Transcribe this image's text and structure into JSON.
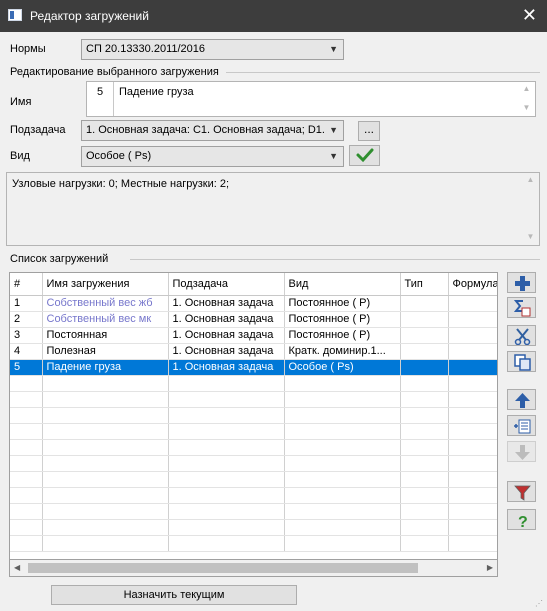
{
  "window": {
    "title": "Редактор загружений",
    "close_glyph": "✕"
  },
  "norms": {
    "label": "Нормы",
    "value": "СП 20.13330.2011/2016"
  },
  "edit_group": {
    "title": "Редактирование выбранного загружения"
  },
  "name": {
    "label": "Имя",
    "number": "5",
    "value": "Падение груза"
  },
  "subtask": {
    "label": "Подзадача",
    "value": "1. Основная задача: C1. Основная задача; D1.",
    "more_label": "..."
  },
  "kind": {
    "label": "Вид",
    "value": "Особое ( Ps)"
  },
  "info": {
    "text": "Узловые нагрузки:  0;  Местные нагрузки:  2;"
  },
  "list": {
    "title": "Список загружений",
    "columns": [
      "#",
      "Имя загружения",
      "Подзадача",
      "Вид",
      "Тип",
      "Формула"
    ],
    "rows": [
      {
        "num": "1",
        "name": "Собственный вес жб",
        "subtask": "1. Основная задача",
        "kind": "Постоянное ( P)",
        "type": "",
        "formula": ""
      },
      {
        "num": "2",
        "name": "Собственный вес мк",
        "subtask": "1. Основная задача",
        "kind": "Постоянное ( P)",
        "type": "",
        "formula": ""
      },
      {
        "num": "3",
        "name": "Постоянная",
        "subtask": "1. Основная задача",
        "kind": "Постоянное ( P)",
        "type": "",
        "formula": ""
      },
      {
        "num": "4",
        "name": "Полезная",
        "subtask": "1. Основная задача",
        "kind": "Кратк. доминир.1...",
        "type": "",
        "formula": ""
      },
      {
        "num": "5",
        "name": "Падение груза",
        "subtask": "1. Основная задача",
        "kind": "Особое ( Ps)",
        "type": "",
        "formula": ""
      }
    ]
  },
  "assign_button": {
    "label": "Назначить текущим"
  },
  "side_buttons": {
    "add": "add-icon",
    "sum": "sum-icon",
    "cut": "cut-icon",
    "copy": "copy-icon",
    "up": "arrow-up-icon",
    "insert": "insert-icon",
    "down": "arrow-down-icon",
    "filter": "filter-icon",
    "help": "help-icon"
  },
  "colors": {
    "selection": "#0078d7",
    "link_text": "#7777cc",
    "titlebar": "#3d3d3d",
    "accent_blue": "#2d5ea8",
    "check_green": "#2f8f2f"
  }
}
